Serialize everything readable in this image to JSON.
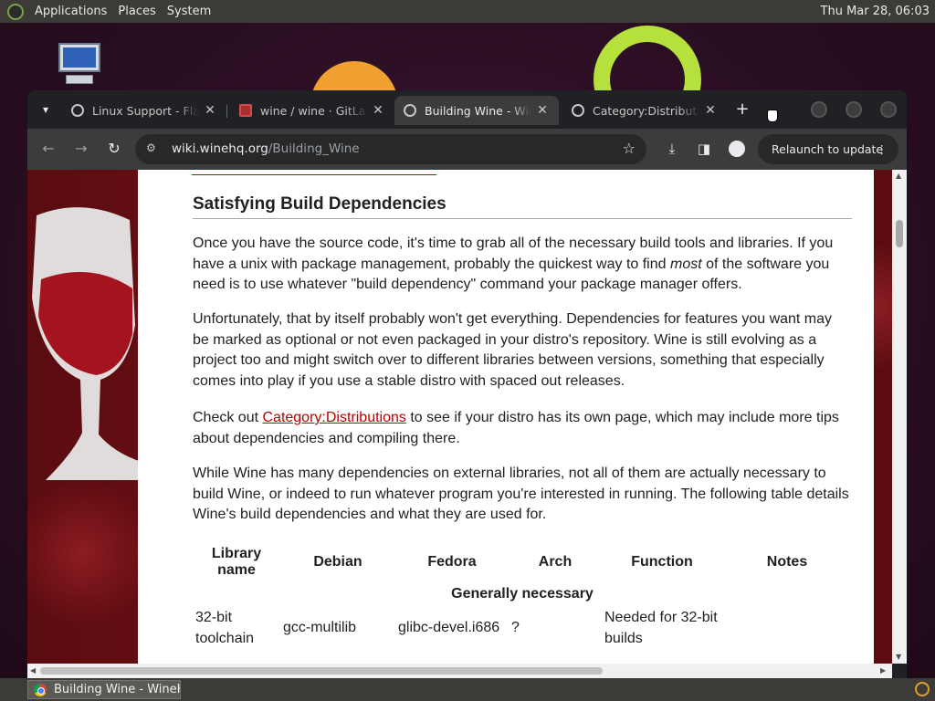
{
  "top_panel": {
    "menus": [
      "Applications",
      "Places",
      "System"
    ],
    "clock": "Thu Mar 28, 06:03"
  },
  "browser": {
    "tabs": [
      {
        "title": "Linux Support - Flathub",
        "icon": "globe-icon"
      },
      {
        "title": "wine / wine · GitLab",
        "icon": "gitlab-icon"
      },
      {
        "title": "Building Wine - WineHQ Wiki",
        "icon": "globe-icon",
        "active": true
      },
      {
        "title": "Category:Distributions",
        "icon": "globe-icon"
      }
    ],
    "url": {
      "host": "wiki.winehq.org",
      "path": "/Building_Wine"
    },
    "relaunch_label": "Relaunch to update"
  },
  "page": {
    "heading": "Satisfying Build Dependencies",
    "p1": "Once you have the source code, it's time to grab all of the necessary build tools and libraries. If you have a unix with package management, probably the quickest way to find ",
    "p1_em": "most",
    "p1_end": " of the software you need is to use whatever \"build dependency\" command your package manager offers.",
    "p2": "Unfortunately, that by itself probably won't get everything. Dependencies for features you want may be marked as optional or not even packaged in your distro's repository. Wine is still evolving as a project too and might switch over to different libraries between versions, something that especially comes into play if you use a stable distro with spaced out releases.",
    "p3_start": "Check out ",
    "p3_link": "Category:Distributions",
    "p3_end": " to see if your distro has its own page, which may include more tips about dependencies and compiling there.",
    "p4": "While Wine has many dependencies on external libraries, not all of them are actually necessary to build Wine, or indeed to run whatever program you're interested in running. The following table details Wine's build dependencies and what they are used for.",
    "table": {
      "headers": [
        "Library name",
        "Debian",
        "Fedora",
        "Arch",
        "Function",
        "Notes"
      ],
      "group": "Generally necessary",
      "rows": [
        [
          "32-bit toolchain",
          "gcc-multilib",
          "glibc-devel.i686",
          "?",
          "Needed for 32-bit builds",
          ""
        ]
      ]
    }
  },
  "taskbar": {
    "task_title": "Building Wine - WineHQ Wiki"
  },
  "colors": {
    "link": "#ba0000",
    "chrome_dark": "#202124",
    "toolbar": "#3c3c3c"
  }
}
